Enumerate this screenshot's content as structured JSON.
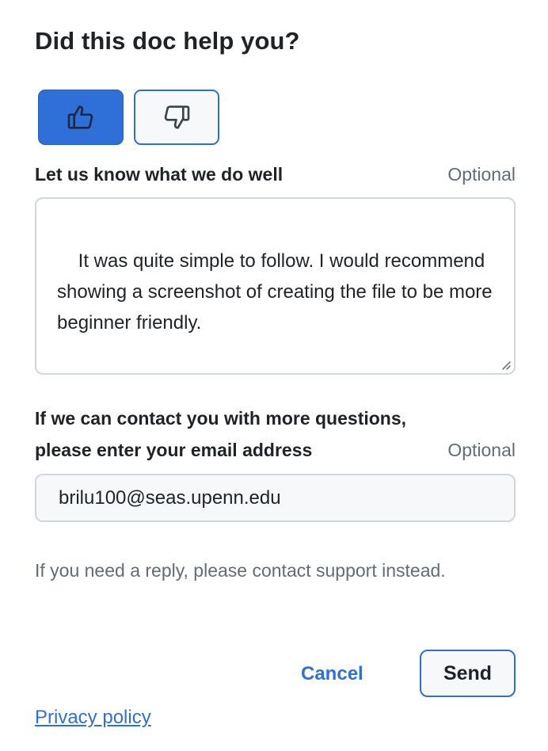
{
  "feedback": {
    "title": "Did this doc help you?",
    "thumbs_up_icon": "thumbs-up-icon",
    "thumbs_down_icon": "thumbs-down-icon",
    "comment_label": "Let us know what we do well",
    "comment_optional": "Optional",
    "comment_value": "It was quite simple to follow. I would recommend showing a screenshot of creating the file to be more beginner friendly.",
    "email_label_line1": "If we can contact you with more questions,",
    "email_label_line2": "please enter your email address",
    "email_optional": "Optional",
    "email_value": "brilu100@seas.upenn.edu",
    "hint": "If you need a reply, please contact support instead.",
    "cancel_label": "Cancel",
    "send_label": "Send",
    "privacy_label": "Privacy policy"
  },
  "colors": {
    "accent": "#2f6fd8",
    "text": "#1f2328",
    "muted": "#636c76",
    "border": "#d0d7de",
    "input_bg": "#f6f8fa"
  }
}
